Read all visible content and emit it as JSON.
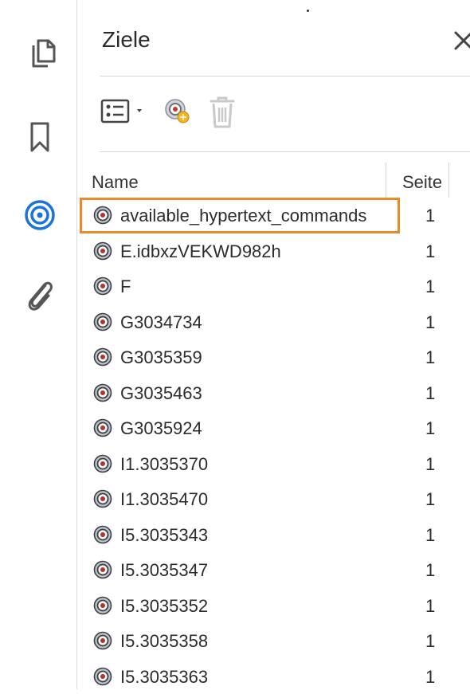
{
  "sidebar": {
    "items": [
      {
        "name": "pages",
        "icon": "pages-icon",
        "active": false
      },
      {
        "name": "bookmarks",
        "icon": "bookmark-icon",
        "active": false
      },
      {
        "name": "destinations",
        "icon": "destinations-icon",
        "active": true
      },
      {
        "name": "attachments",
        "icon": "paperclip-icon",
        "active": false
      }
    ],
    "accent_color": "#1a73d9"
  },
  "panel": {
    "title": "Ziele",
    "close_icon": "close-icon",
    "toolbar": {
      "options_icon": "options-menu-icon",
      "new_destination_icon": "new-destination-icon",
      "delete_icon": "trash-icon"
    },
    "table": {
      "headers": {
        "name": "Name",
        "page": "Seite"
      },
      "selection_color": "#e8892a",
      "rows": [
        {
          "name": "available_hypertext_commands",
          "page": "1",
          "selected": true
        },
        {
          "name": "E.idbxzVEKWD982h",
          "page": "1"
        },
        {
          "name": "F",
          "page": "1"
        },
        {
          "name": "G3034734",
          "page": "1"
        },
        {
          "name": "G3035359",
          "page": "1"
        },
        {
          "name": "G3035463",
          "page": "1"
        },
        {
          "name": "G3035924",
          "page": "1"
        },
        {
          "name": "I1.3035370",
          "page": "1"
        },
        {
          "name": "I1.3035470",
          "page": "1"
        },
        {
          "name": "I5.3035343",
          "page": "1"
        },
        {
          "name": "I5.3035347",
          "page": "1"
        },
        {
          "name": "I5.3035352",
          "page": "1"
        },
        {
          "name": "I5.3035358",
          "page": "1"
        },
        {
          "name": "I5.3035363",
          "page": "1"
        }
      ]
    }
  }
}
